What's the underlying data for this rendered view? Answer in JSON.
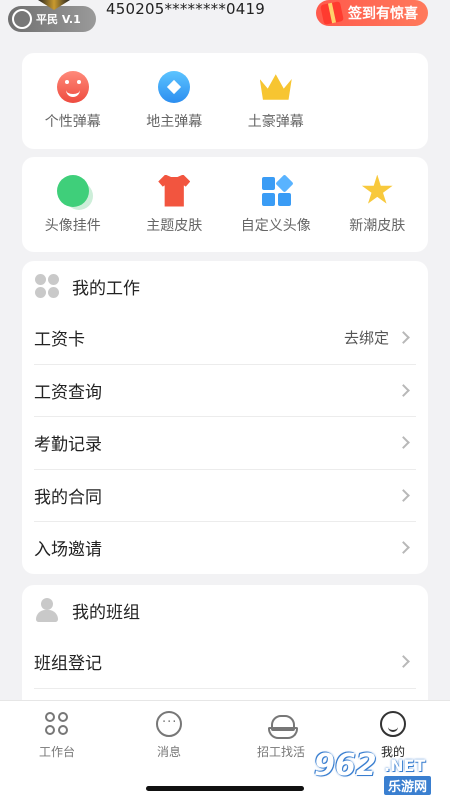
{
  "header": {
    "badge_text": "平民 V.1",
    "masked_id": "450205********0419",
    "checkin_label": "签到有惊喜"
  },
  "danmaku": {
    "items": [
      {
        "label": "个性弹幕",
        "icon": "smile-icon"
      },
      {
        "label": "地主弹幕",
        "icon": "diamond-icon"
      },
      {
        "label": "土豪弹幕",
        "icon": "crown-icon"
      }
    ]
  },
  "skins": {
    "items": [
      {
        "label": "头像挂件",
        "icon": "bubble-icon"
      },
      {
        "label": "主题皮肤",
        "icon": "shirt-icon"
      },
      {
        "label": "自定义头像",
        "icon": "blocks-icon"
      },
      {
        "label": "新潮皮肤",
        "icon": "star-icon"
      }
    ]
  },
  "my_work": {
    "title": "我的工作",
    "rows": [
      {
        "label": "工资卡",
        "value": "去绑定"
      },
      {
        "label": "工资查询",
        "value": ""
      },
      {
        "label": "考勤记录",
        "value": ""
      },
      {
        "label": "我的合同",
        "value": ""
      },
      {
        "label": "入场邀请",
        "value": ""
      }
    ]
  },
  "my_team": {
    "title": "我的班组",
    "rows": [
      {
        "label": "班组登记",
        "value": ""
      }
    ]
  },
  "tabbar": {
    "tabs": [
      {
        "label": "工作台",
        "icon": "workbench-icon",
        "active": false
      },
      {
        "label": "消息",
        "icon": "message-icon",
        "active": false
      },
      {
        "label": "招工找活",
        "icon": "hardhat-icon",
        "active": false
      },
      {
        "label": "我的",
        "icon": "profile-icon",
        "active": true
      }
    ]
  },
  "watermark": {
    "brand": "962",
    "suffix": ".NET",
    "caption": "乐游网"
  },
  "colors": {
    "background": "#f2f2f4",
    "card": "#ffffff",
    "checkin": "#ff5a4c",
    "chevron": "#b8b8b8"
  }
}
